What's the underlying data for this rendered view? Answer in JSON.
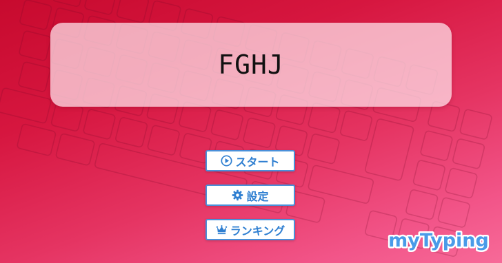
{
  "title": "FGHJ",
  "menu": {
    "start_label": "スタート",
    "settings_label": "設定",
    "ranking_label": "ランキング"
  },
  "logo_text": "myTyping",
  "icons": {
    "start": "play-circle-icon",
    "settings": "gear-icon",
    "ranking": "crown-icon"
  },
  "colors": {
    "accent": "#2f7fd1",
    "background_top": "#c70a2e",
    "background_bottom": "#f76a98",
    "logo_fill": "#4a9be8"
  }
}
